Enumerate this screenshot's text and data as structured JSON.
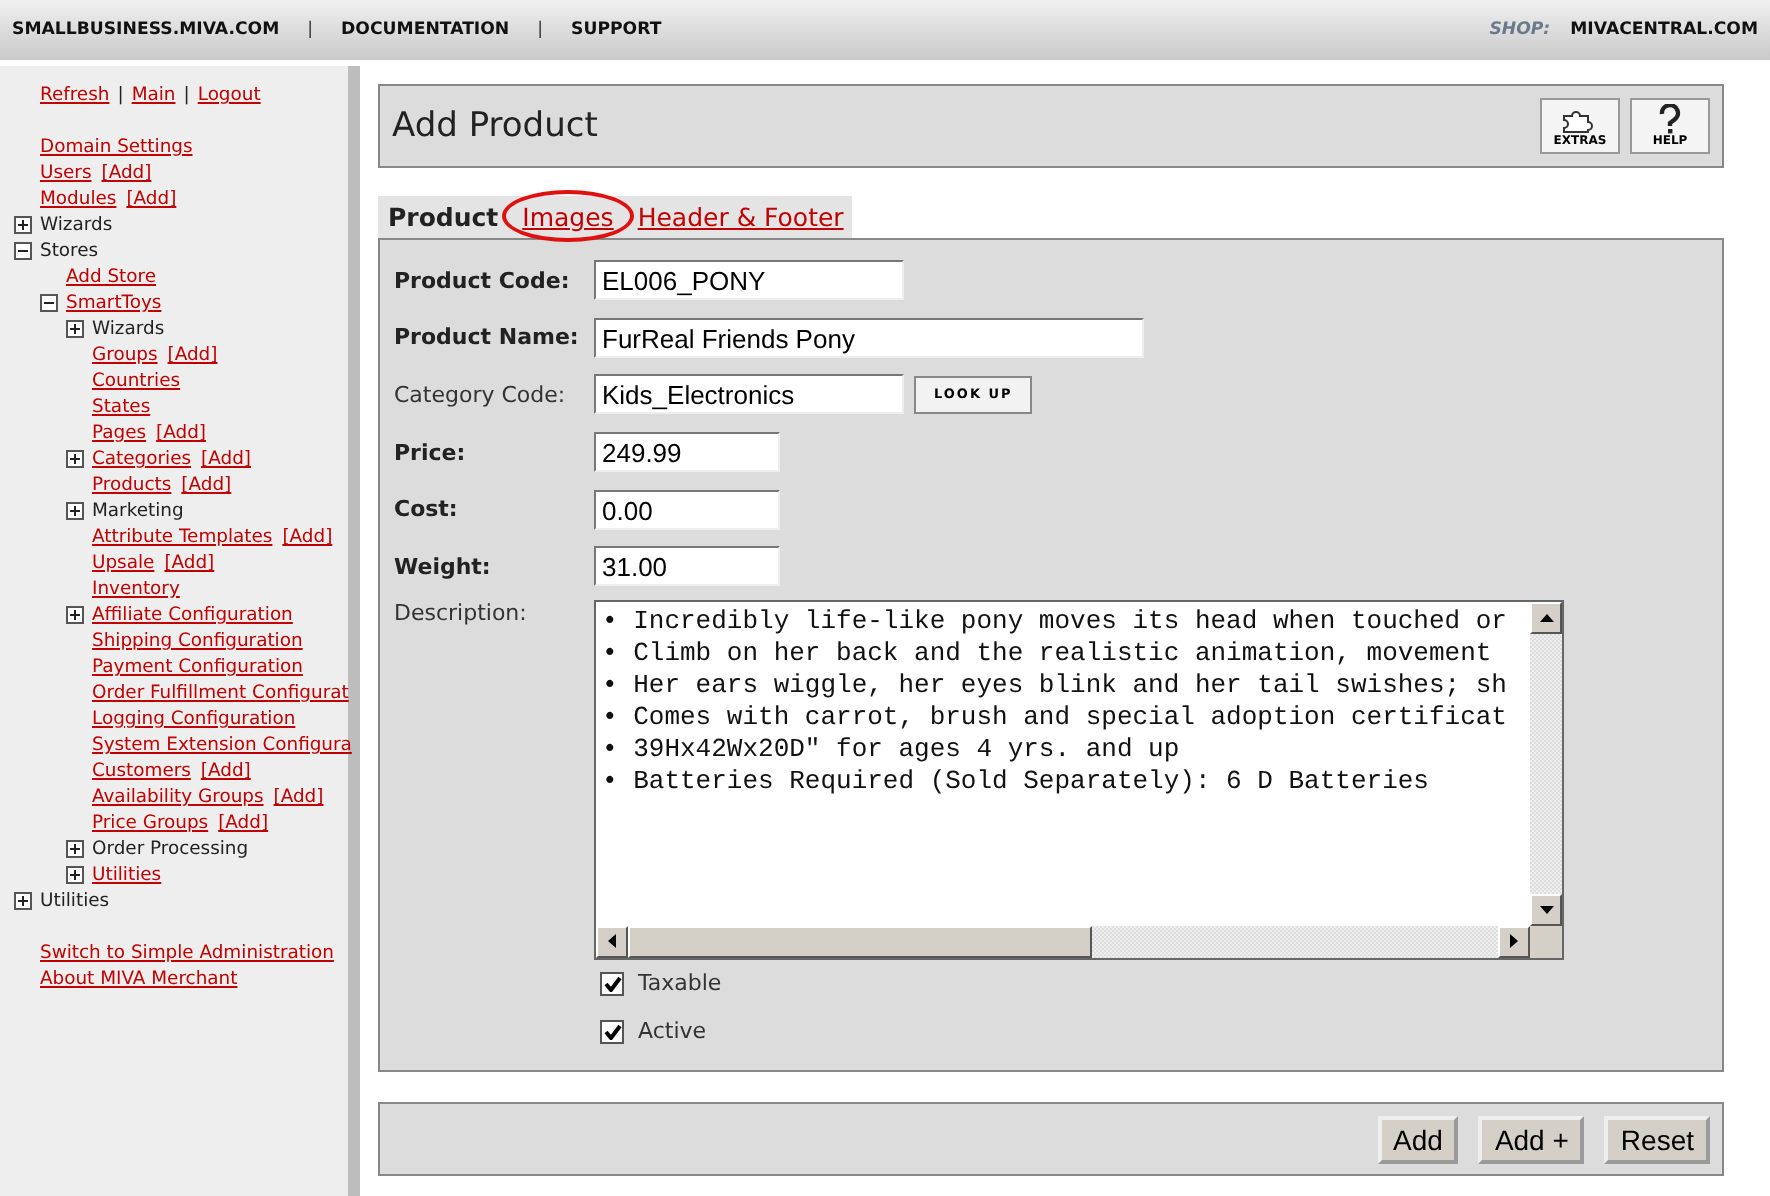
{
  "top_bar": {
    "links": [
      "SMALLBUSINESS.MIVA.COM",
      "DOCUMENTATION",
      "SUPPORT"
    ],
    "separators": [
      "|",
      "|"
    ],
    "shop_label": "SHOP:",
    "shop_link": "MIVACENTRAL.COM"
  },
  "sidebar": {
    "session_links": [
      "Refresh",
      "Main",
      "Logout"
    ],
    "session_separators": [
      "|",
      "|"
    ],
    "items": [
      {
        "label": "Domain Settings",
        "kind": "link"
      },
      {
        "label": "Users",
        "kind": "link",
        "add": "[Add]"
      },
      {
        "label": "Modules",
        "kind": "link",
        "add": "[Add]"
      },
      {
        "label": "Wizards",
        "kind": "text",
        "expanded": false
      },
      {
        "label": "Stores",
        "kind": "text",
        "expanded": true,
        "children": [
          {
            "label": "Add Store",
            "kind": "link"
          },
          {
            "label": "SmartToys",
            "kind": "link",
            "expanded": true,
            "children": [
              {
                "label": "Wizards",
                "kind": "text",
                "expanded": false
              },
              {
                "label": "Groups",
                "kind": "link",
                "add": "[Add]"
              },
              {
                "label": "Countries",
                "kind": "link"
              },
              {
                "label": "States",
                "kind": "link"
              },
              {
                "label": "Pages",
                "kind": "link",
                "add": "[Add]"
              },
              {
                "label": "Categories",
                "kind": "link",
                "add": "[Add]",
                "expanded": false
              },
              {
                "label": "Products",
                "kind": "link",
                "add": "[Add]"
              },
              {
                "label": "Marketing",
                "kind": "text",
                "expanded": false
              },
              {
                "label": "Attribute Templates",
                "kind": "link",
                "add": "[Add]"
              },
              {
                "label": "Upsale",
                "kind": "link",
                "add": "[Add]"
              },
              {
                "label": "Inventory",
                "kind": "link"
              },
              {
                "label": "Affiliate Configuration",
                "kind": "link",
                "expanded": false
              },
              {
                "label": "Shipping Configuration",
                "kind": "link"
              },
              {
                "label": "Payment Configuration",
                "kind": "link"
              },
              {
                "label": "Order Fulfillment Configurat",
                "kind": "link"
              },
              {
                "label": "Logging Configuration",
                "kind": "link"
              },
              {
                "label": "System Extension Configura",
                "kind": "link"
              },
              {
                "label": "Customers",
                "kind": "link",
                "add": "[Add]"
              },
              {
                "label": "Availability Groups",
                "kind": "link",
                "add": "[Add]"
              },
              {
                "label": "Price Groups",
                "kind": "link",
                "add": "[Add]"
              },
              {
                "label": "Order Processing",
                "kind": "text",
                "expanded": false
              },
              {
                "label": "Utilities",
                "kind": "link",
                "expanded": false
              }
            ]
          }
        ]
      },
      {
        "label": "Utilities",
        "kind": "text",
        "expanded": false
      }
    ],
    "footer_links": [
      "Switch to Simple Administration",
      "About MIVA Merchant"
    ]
  },
  "header": {
    "title": "Add Product",
    "buttons": [
      "EXTRAS",
      "HELP"
    ]
  },
  "tabs": [
    {
      "label": "Product",
      "selected": true
    },
    {
      "label": "Images",
      "selected": false,
      "circled": true
    },
    {
      "label": "Header & Footer",
      "selected": false
    }
  ],
  "fields": [
    {
      "label": "Product Code:",
      "required": true,
      "value": "EL006_PONY",
      "kind": "medium"
    },
    {
      "label": "Product Name:",
      "required": true,
      "value": "FurReal Friends Pony",
      "kind": "wide"
    },
    {
      "label": "Category Code:",
      "required": false,
      "value": "Kids_Electronics",
      "kind": "medium",
      "button": "LOOK UP"
    },
    {
      "label": "Price:",
      "required": true,
      "value": "249.99",
      "kind": "narrow"
    },
    {
      "label": "Cost:",
      "required": true,
      "value": "0.00",
      "kind": "narrow"
    },
    {
      "label": "Weight:",
      "required": true,
      "value": "31.00",
      "kind": "narrow"
    }
  ],
  "description": {
    "label": "Description:",
    "lines": [
      "• Incredibly life-like pony moves its head when touched or",
      "• Climb on her back and the realistic animation, movement",
      "• Her ears wiggle, her eyes blink and her tail swishes; sh",
      "• Comes with carrot, brush and special adoption certificat",
      "• 39Hx42Wx20D\" for ages 4 yrs. and up",
      "• Batteries Required (Sold Separately): 6 D Batteries"
    ]
  },
  "checkboxes": [
    {
      "label": "Taxable",
      "checked": true
    },
    {
      "label": "Active",
      "checked": true
    }
  ],
  "actions": [
    "Add",
    "Add +",
    "Reset"
  ]
}
